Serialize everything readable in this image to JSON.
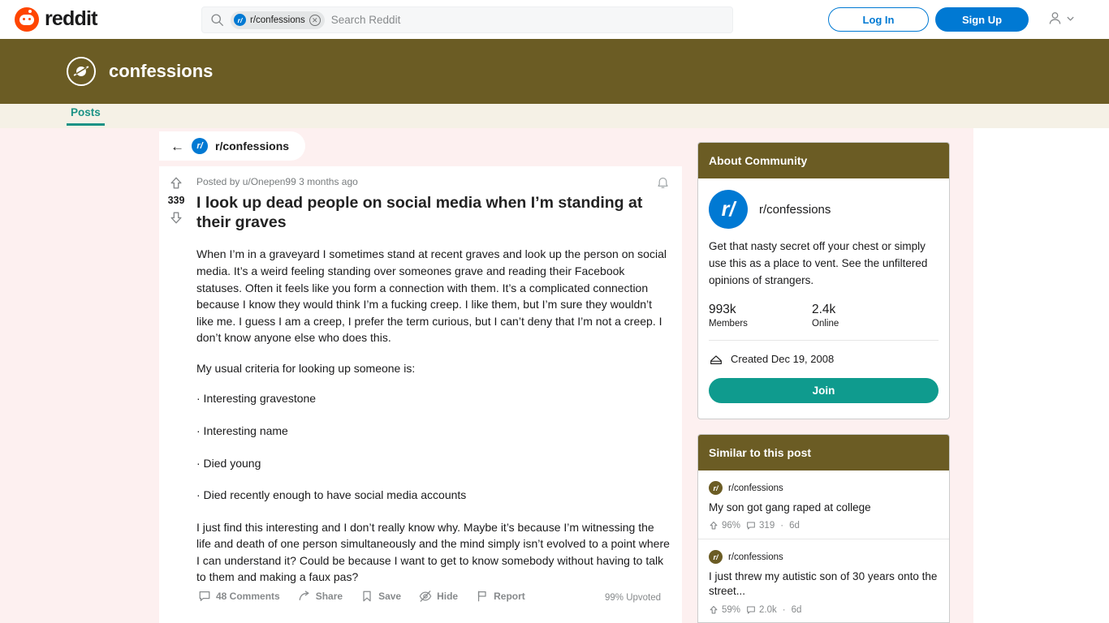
{
  "topnav": {
    "logo_text": "reddit",
    "search": {
      "chip_label": "r/confessions",
      "chip_avatar_text": "r/",
      "placeholder": "Search Reddit",
      "value": ""
    },
    "login_label": "Log In",
    "signup_label": "Sign Up"
  },
  "banner": {
    "title": "confessions",
    "bg_color": "#6b5c24"
  },
  "tabs": [
    {
      "label": "Posts",
      "active": true,
      "accent_color": "#1b9285"
    }
  ],
  "breadcrumb": {
    "back_label": "←",
    "avatar_text": "r/",
    "label": "r/confessions"
  },
  "post": {
    "score": "339",
    "meta": "Posted by u/Onepen99 3 months ago",
    "title": "I look up dead people on social media when I’m standing at their graves",
    "paragraphs": [
      "When I’m in a graveyard I sometimes stand at recent graves and look up the person on social media. It’s a weird feeling standing over someones grave and reading their Facebook statuses. Often it feels like you form a connection with them. It’s a complicated connection because I know they would think I’m a fucking creep. I like them, but I’m sure they wouldn’t like me. I guess I am a creep, I prefer the term curious, but I can’t deny that I’m not a creep. I don’t know anyone else who does this.",
      "My usual criteria for looking up someone is:"
    ],
    "bullets": [
      "· Interesting gravestone",
      "· Interesting name",
      "· Died young",
      "· Died recently enough to have social media accounts"
    ],
    "closing_paragraph": "I just find this interesting and I don’t really know why. Maybe it’s because I’m witnessing the life and death of one person simultaneously and the mind simply isn’t evolved to a point where I can understand it? Could be because I want to get to know somebody without having to talk to them and making a faux pas?",
    "actions": [
      {
        "icon": "comment-icon",
        "label": "48 Comments"
      },
      {
        "icon": "share-icon",
        "label": "Share"
      },
      {
        "icon": "save-icon",
        "label": "Save"
      },
      {
        "icon": "hide-icon",
        "label": "Hide"
      },
      {
        "icon": "report-icon",
        "label": "Report"
      }
    ],
    "upvoted_percent": "99% Upvoted"
  },
  "sidebar": {
    "about": {
      "header": "About Community",
      "avatar_text": "r/",
      "name": "r/confessions",
      "description": "Get that nasty secret off your chest or simply use this as a place to vent. See the unfiltered opinions of strangers.",
      "stats": [
        {
          "value": "993k",
          "label": "Members"
        },
        {
          "value": "2.4k",
          "label": "Online"
        }
      ],
      "created": "Created Dec 19, 2008",
      "join_label": "Join",
      "join_color": "#0f9b8e"
    },
    "similar": {
      "header": "Similar to this post",
      "items": [
        {
          "subreddit": "r/confessions",
          "avatar_text": "r/",
          "title": "My son got gang raped at college",
          "upvote_pct": "96%",
          "comments": "319",
          "age": "6d"
        },
        {
          "subreddit": "r/confessions",
          "avatar_text": "r/",
          "title": "I just threw my autistic son of 30 years onto the street...",
          "upvote_pct": "59%",
          "comments": "2.0k",
          "age": "6d"
        }
      ]
    }
  }
}
